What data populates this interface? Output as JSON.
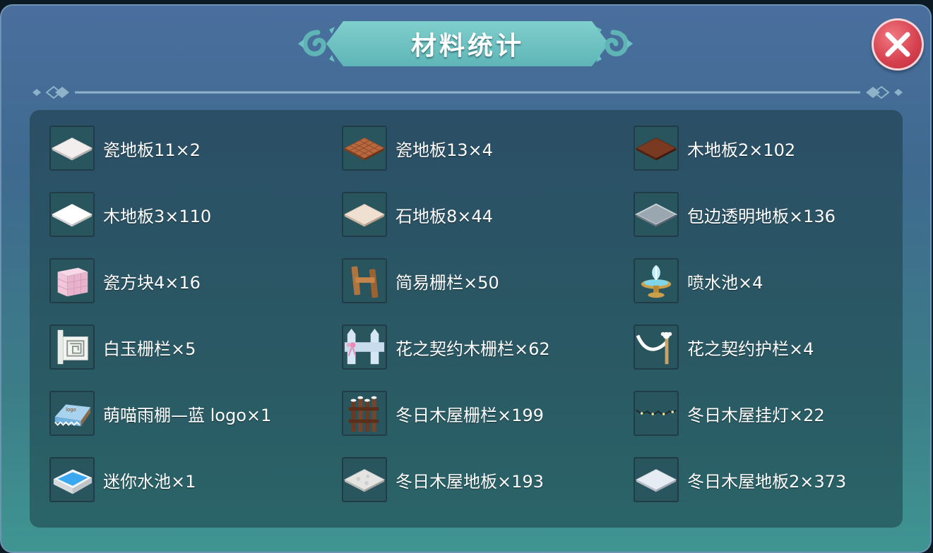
{
  "window": {
    "title": "材料统计"
  },
  "items": [
    {
      "label": "瓷地板11×2",
      "icon": "white-tile-floor-icon"
    },
    {
      "label": "瓷地板13×4",
      "icon": "brown-tile-floor-icon"
    },
    {
      "label": "木地板2×102",
      "icon": "dark-wood-floor-icon"
    },
    {
      "label": "木地板3×110",
      "icon": "white-wood-floor-icon"
    },
    {
      "label": "石地板8×44",
      "icon": "beige-stone-floor-icon"
    },
    {
      "label": "包边透明地板×136",
      "icon": "transparent-floor-icon"
    },
    {
      "label": "瓷方块4×16",
      "icon": "pink-cube-icon"
    },
    {
      "label": "简易栅栏×50",
      "icon": "simple-fence-icon"
    },
    {
      "label": "喷水池×4",
      "icon": "fountain-icon"
    },
    {
      "label": "白玉栅栏×5",
      "icon": "jade-fence-icon"
    },
    {
      "label": "花之契约木栅栏×62",
      "icon": "flower-wood-fence-icon"
    },
    {
      "label": "花之契约护栏×4",
      "icon": "flower-railing-icon"
    },
    {
      "label": "萌喵雨棚—蓝 logo×1",
      "icon": "blue-awning-icon"
    },
    {
      "label": "冬日木屋栅栏×199",
      "icon": "winter-cabin-fence-icon"
    },
    {
      "label": "冬日木屋挂灯×22",
      "icon": "winter-string-lights-icon"
    },
    {
      "label": "迷你水池×1",
      "icon": "mini-pool-icon"
    },
    {
      "label": "冬日木屋地板×193",
      "icon": "winter-cabin-floor-icon"
    },
    {
      "label": "冬日木屋地板2×373",
      "icon": "winter-cabin-floor-2-icon"
    }
  ]
}
